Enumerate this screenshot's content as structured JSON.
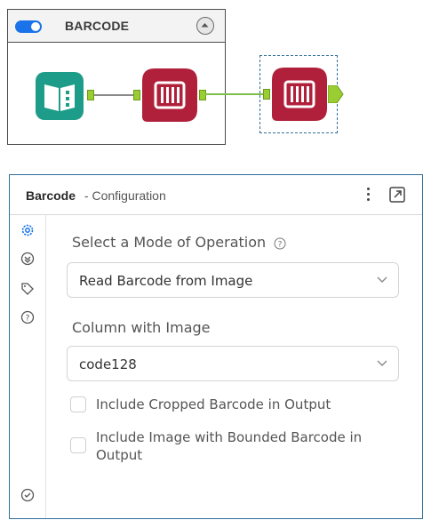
{
  "container": {
    "title": "BARCODE",
    "enabled": true
  },
  "colors": {
    "accent": "#1a73e8",
    "barcode_tool": "#b0203a",
    "input_tool": "#1e9c8a",
    "anchor": "#9acd32",
    "wire": "#7cbf4a",
    "panel_border": "#2f6f9a"
  },
  "workflow": {
    "tools": [
      {
        "name": "Directory",
        "icon": "folder-book-icon"
      },
      {
        "name": "Barcode",
        "icon": "barcode-icon"
      },
      {
        "name": "Barcode",
        "icon": "barcode-icon",
        "selected": true
      }
    ]
  },
  "panel": {
    "tool_name": "Barcode",
    "subtitle": "- Configuration",
    "sidebar": [
      "gear-icon",
      "connection-icon",
      "tag-icon",
      "help-icon",
      "check-circle-icon"
    ],
    "mode_label": "Select a Mode of Operation",
    "mode_value": "Read Barcode from Image",
    "column_label": "Column with Image",
    "column_value": "code128",
    "options": [
      {
        "label": "Include Cropped Barcode in Output",
        "checked": false
      },
      {
        "label": "Include Image with Bounded Barcode in Output",
        "checked": false
      }
    ]
  }
}
